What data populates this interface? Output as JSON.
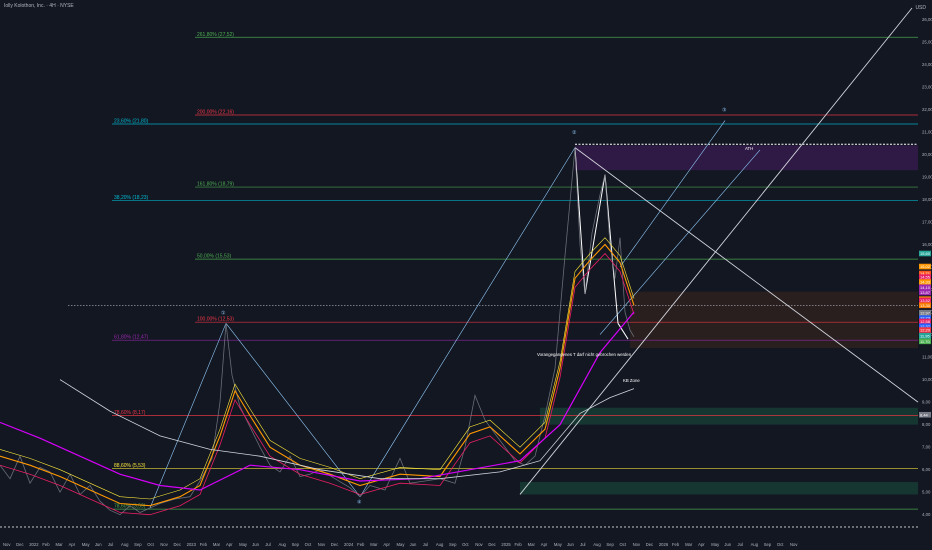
{
  "header": {
    "title": "Iolly Kolothon, Inc. · 4H · NYSE",
    "corner_label": "USD"
  },
  "chart_data": {
    "type": "line",
    "title": "Iolly Kolothon, Inc. · 4H · NYSE",
    "ylim": [
      3.5,
      26.5
    ],
    "price_axis": [
      "26,00",
      "25,00",
      "24,00",
      "23,00",
      "22,00",
      "21,00",
      "20,00",
      "19,00",
      "18,00",
      "17,00",
      "16,00",
      "15,00",
      "14,00",
      "13,00",
      "12,00",
      "11,00",
      "10,00",
      "9,00",
      "8,00",
      "7,00",
      "6,00",
      "5,00",
      "4,00"
    ],
    "time_axis": [
      "Nov",
      "Dec",
      "2022",
      "Feb",
      "Mar",
      "Apr",
      "May",
      "Jun",
      "Jul",
      "Aug",
      "Sep",
      "Oct",
      "Nov",
      "Dec",
      "2023",
      "Feb",
      "Mar",
      "Apr",
      "May",
      "Jun",
      "Jul",
      "Aug",
      "Sep",
      "Oct",
      "Nov",
      "Dec",
      "2024",
      "Feb",
      "Mar",
      "Apr",
      "May",
      "Jun",
      "Jul",
      "Aug",
      "Sep",
      "Oct",
      "Nov",
      "Dec",
      "2025",
      "Feb",
      "Mar",
      "Apr",
      "May",
      "Jun",
      "Jul",
      "Aug",
      "Sep",
      "Oct",
      "Nov",
      "Dec",
      "2026",
      "Feb",
      "Mar",
      "Apr",
      "May",
      "Jun",
      "Jul",
      "Aug",
      "Sep",
      "Oct",
      "Nov"
    ],
    "fib_levels": [
      {
        "label": "261,80% (27,52)",
        "price": 25.2,
        "color": "#4caf50"
      },
      {
        "label": "200,00% (22,16)",
        "price": 21.75,
        "color": "#f23645"
      },
      {
        "label": "23,60% (21,80)",
        "price": 21.35,
        "color": "#00bcd4"
      },
      {
        "label": "161,80% (18,79)",
        "price": 18.55,
        "color": "#4caf50"
      },
      {
        "label": "38,20% (18,23)",
        "price": 17.95,
        "color": "#00bcd4"
      },
      {
        "label": "50,00% (15,53)",
        "price": 15.35,
        "color": "#4caf50"
      },
      {
        "label": "100,00% (12,53)",
        "price": 12.55,
        "color": "#f23645"
      },
      {
        "label": "61,80% (12,47)",
        "price": 11.75,
        "color": "#9c27b0"
      },
      {
        "label": "78,60% (8,17)",
        "price": 8.4,
        "color": "#f23645"
      },
      {
        "label": "88,60% (5,53)",
        "price": 6.05,
        "color": "#ffeb3b"
      },
      {
        "label": "78,60% (3,59)",
        "price": 4.25,
        "color": "#4caf50"
      }
    ],
    "annotations": [
      "Vorangegangenes T darf nicht gebrochen werden",
      "ATH",
      "KB Zone"
    ],
    "price_tags": [
      {
        "text": "15,60",
        "color": "#26a69a"
      },
      {
        "text": "15,02",
        "color": "#ff9800"
      },
      {
        "text": "14,71",
        "color": "#ff5722"
      },
      {
        "text": "14,55",
        "color": "#e91e63"
      },
      {
        "text": "14,33",
        "color": "#ff9800"
      },
      {
        "text": "14,10",
        "color": "#9c27b0"
      },
      {
        "text": "13,87",
        "color": "#9c27b0"
      },
      {
        "text": "13,57",
        "color": "#ff9800"
      },
      {
        "text": "13,52",
        "color": "#e91e63"
      },
      {
        "text": "13,30",
        "color": "#f57c00"
      },
      {
        "text": "12,97",
        "color": "#787b86"
      },
      {
        "text": "12,73",
        "color": "#2962ff"
      },
      {
        "text": "12,58",
        "color": "#e91e63"
      },
      {
        "text": "12,37",
        "color": "#2962ff"
      },
      {
        "text": "12,20",
        "color": "#f23645"
      },
      {
        "text": "11,95",
        "color": "#26a69a"
      },
      {
        "text": "11,70",
        "color": "#4caf50"
      },
      {
        "text": "8,44",
        "color": "#787b86"
      }
    ],
    "grid": false,
    "legend": "none"
  }
}
